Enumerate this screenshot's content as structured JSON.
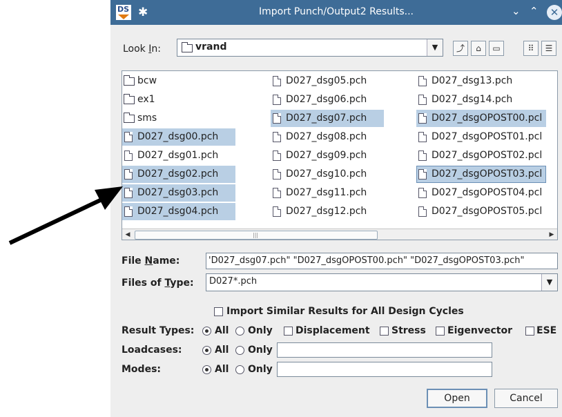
{
  "window": {
    "title": "Import Punch/Output2 Results...",
    "app_badge": "DS"
  },
  "look_in": {
    "label": "Look In:",
    "value": "vrand"
  },
  "files": [
    {
      "name": "bcw",
      "type": "folder",
      "selected": false,
      "col": 0,
      "row": 0
    },
    {
      "name": "ex1",
      "type": "folder",
      "selected": false,
      "col": 0,
      "row": 1
    },
    {
      "name": "sms",
      "type": "folder",
      "selected": false,
      "col": 0,
      "row": 2
    },
    {
      "name": "D027_dsg00.pch",
      "type": "file",
      "selected": true,
      "col": 0,
      "row": 3
    },
    {
      "name": "D027_dsg01.pch",
      "type": "file",
      "selected": false,
      "col": 0,
      "row": 4
    },
    {
      "name": "D027_dsg02.pch",
      "type": "file",
      "selected": true,
      "col": 0,
      "row": 5
    },
    {
      "name": "D027_dsg03.pch",
      "type": "file",
      "selected": true,
      "col": 0,
      "row": 6
    },
    {
      "name": "D027_dsg04.pch",
      "type": "file",
      "selected": true,
      "col": 0,
      "row": 7
    },
    {
      "name": "D027_dsg05.pch",
      "type": "file",
      "selected": false,
      "col": 1,
      "row": 0
    },
    {
      "name": "D027_dsg06.pch",
      "type": "file",
      "selected": false,
      "col": 1,
      "row": 1
    },
    {
      "name": "D027_dsg07.pch",
      "type": "file",
      "selected": true,
      "col": 1,
      "row": 2
    },
    {
      "name": "D027_dsg08.pch",
      "type": "file",
      "selected": false,
      "col": 1,
      "row": 3
    },
    {
      "name": "D027_dsg09.pch",
      "type": "file",
      "selected": false,
      "col": 1,
      "row": 4
    },
    {
      "name": "D027_dsg10.pch",
      "type": "file",
      "selected": false,
      "col": 1,
      "row": 5
    },
    {
      "name": "D027_dsg11.pch",
      "type": "file",
      "selected": false,
      "col": 1,
      "row": 6
    },
    {
      "name": "D027_dsg12.pch",
      "type": "file",
      "selected": false,
      "col": 1,
      "row": 7
    },
    {
      "name": "D027_dsg13.pch",
      "type": "file",
      "selected": false,
      "col": 2,
      "row": 0
    },
    {
      "name": "D027_dsg14.pch",
      "type": "file",
      "selected": false,
      "col": 2,
      "row": 1
    },
    {
      "name": "D027_dsgOPOST00.pcl",
      "type": "file",
      "selected": true,
      "col": 2,
      "row": 2
    },
    {
      "name": "D027_dsgOPOST01.pcl",
      "type": "file",
      "selected": false,
      "col": 2,
      "row": 3
    },
    {
      "name": "D027_dsgOPOST02.pcl",
      "type": "file",
      "selected": false,
      "col": 2,
      "row": 4
    },
    {
      "name": "D027_dsgOPOST03.pcl",
      "type": "file",
      "selected": true,
      "focused": true,
      "col": 2,
      "row": 5
    },
    {
      "name": "D027_dsgOPOST04.pcl",
      "type": "file",
      "selected": false,
      "col": 2,
      "row": 6
    },
    {
      "name": "D027_dsgOPOST05.pcl",
      "type": "file",
      "selected": false,
      "col": 2,
      "row": 7
    }
  ],
  "file_name": {
    "label_pre": "File ",
    "label_u": "N",
    "label_post": "ame:",
    "value": "'D027_dsg07.pch\" \"D027_dsgOPOST00.pch\" \"D027_dsgOPOST03.pch\""
  },
  "files_of_type": {
    "label_pre": "Files of ",
    "label_u": "T",
    "label_post": "ype:",
    "value": "D027*.pch"
  },
  "import_similar": {
    "label": "Import Similar Results for All Design Cycles",
    "checked": false
  },
  "result_types": {
    "label": "Result Types:",
    "all": "All",
    "only": "Only",
    "displacement": "Displacement",
    "stress": "Stress",
    "eigenvector": "Eigenvector",
    "ese": "ESE"
  },
  "loadcases": {
    "label": "Loadcases:",
    "all": "All",
    "only": "Only",
    "value": ""
  },
  "modes": {
    "label": "Modes:",
    "all": "All",
    "only": "Only",
    "value": ""
  },
  "buttons": {
    "open": "Open",
    "cancel": "Cancel"
  },
  "icons": [
    "app-icon",
    "pin-icon",
    "minimize-icon",
    "maximize-icon",
    "close-icon",
    "folder-icon",
    "file-icon",
    "up-folder-icon",
    "home-icon",
    "new-folder-icon",
    "list-view-icon",
    "details-view-icon",
    "arrow-annotation"
  ]
}
